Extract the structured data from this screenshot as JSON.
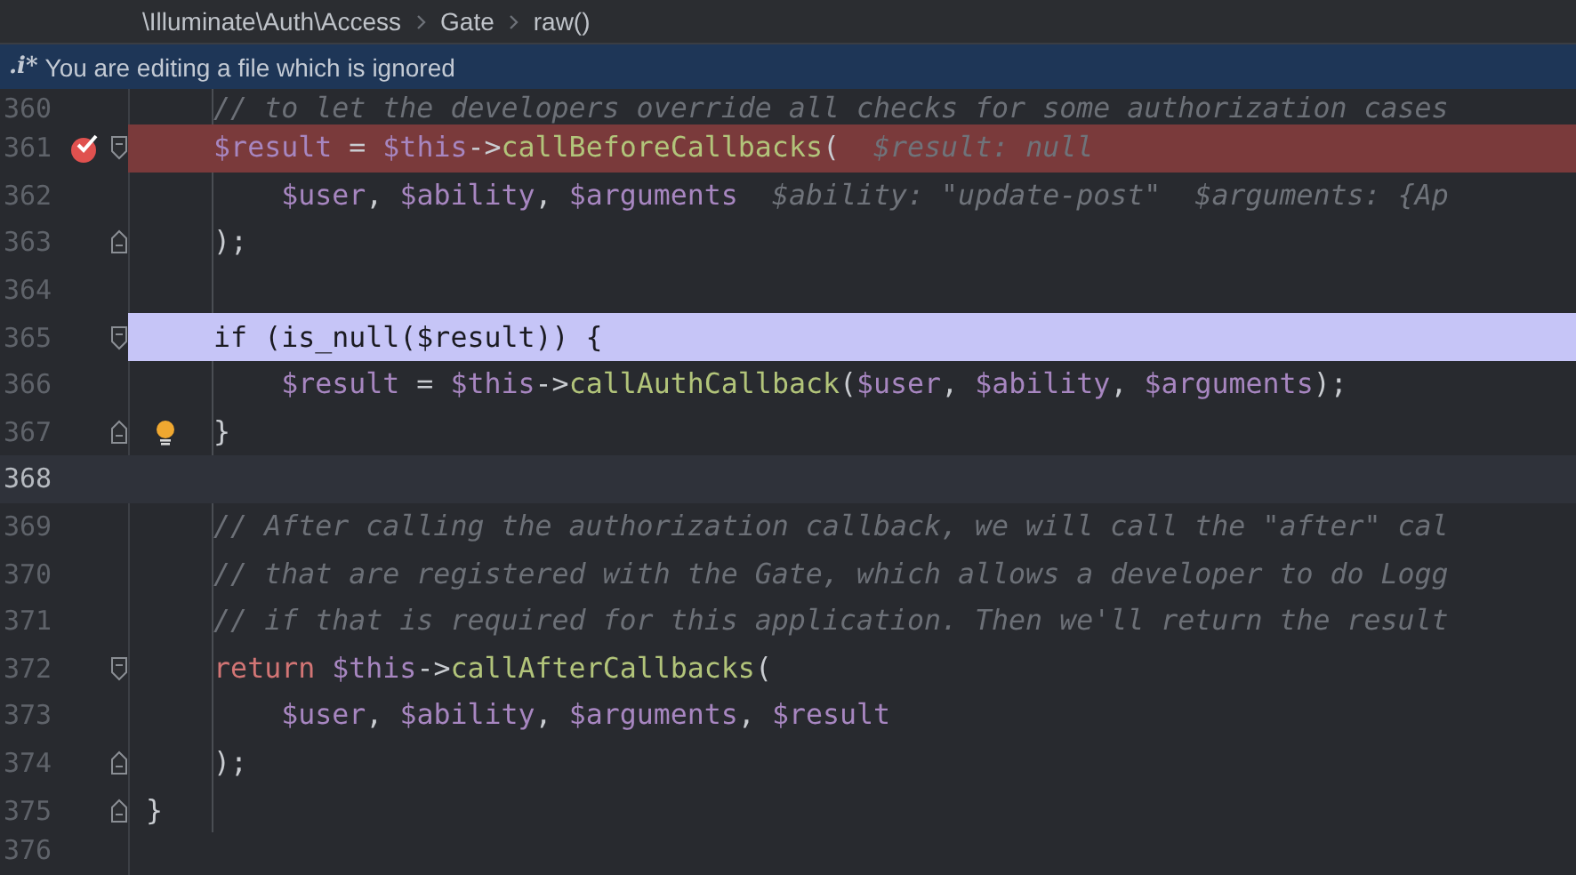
{
  "breadcrumbs": [
    "\\Illuminate\\Auth\\Access",
    "Gate",
    "raw()"
  ],
  "notice": {
    "prefix": ".i*",
    "text": "You are editing a file which is ignored"
  },
  "lines": [
    {
      "number": "360",
      "breakpoint": false,
      "execution_point": false,
      "caret_line": false,
      "fold_start": false,
      "fold_end": false,
      "bulb": false,
      "tokens": [
        {
          "kind": "comment",
          "text": "    // to let the developers override all checks for some authorization cases"
        }
      ]
    },
    {
      "number": "361",
      "breakpoint": true,
      "execution_point": false,
      "caret_line": false,
      "fold_start": true,
      "fold_end": false,
      "bulb": false,
      "tokens": [
        {
          "kind": "var",
          "text": "    $result"
        },
        {
          "kind": "plain",
          "text": " = "
        },
        {
          "kind": "var",
          "text": "$this"
        },
        {
          "kind": "plain",
          "text": "->"
        },
        {
          "kind": "func",
          "text": "callBeforeCallbacks"
        },
        {
          "kind": "plain",
          "text": "(  "
        },
        {
          "kind": "hint",
          "text": "$result: null"
        }
      ]
    },
    {
      "number": "362",
      "breakpoint": false,
      "execution_point": false,
      "caret_line": false,
      "fold_start": false,
      "fold_end": false,
      "bulb": false,
      "tokens": [
        {
          "kind": "var",
          "text": "        $user"
        },
        {
          "kind": "plain",
          "text": ", "
        },
        {
          "kind": "var",
          "text": "$ability"
        },
        {
          "kind": "plain",
          "text": ", "
        },
        {
          "kind": "var",
          "text": "$arguments"
        },
        {
          "kind": "hint",
          "text": "  $ability: \"update-post\"  $arguments: {Ap"
        }
      ]
    },
    {
      "number": "363",
      "breakpoint": false,
      "execution_point": false,
      "caret_line": false,
      "fold_start": false,
      "fold_end": true,
      "bulb": false,
      "tokens": [
        {
          "kind": "plain",
          "text": "    );"
        }
      ]
    },
    {
      "number": "364",
      "breakpoint": false,
      "execution_point": false,
      "caret_line": false,
      "fold_start": false,
      "fold_end": false,
      "bulb": false
    },
    {
      "number": "365",
      "breakpoint": false,
      "execution_point": true,
      "caret_line": false,
      "fold_start": true,
      "fold_end": false,
      "bulb": false,
      "tokens": [
        {
          "kind": "plain",
          "text": "    if (is_null($result)) {"
        }
      ]
    },
    {
      "number": "366",
      "breakpoint": false,
      "execution_point": false,
      "caret_line": false,
      "fold_start": false,
      "fold_end": false,
      "bulb": false,
      "tokens": [
        {
          "kind": "var",
          "text": "        $result"
        },
        {
          "kind": "plain",
          "text": " = "
        },
        {
          "kind": "var",
          "text": "$this"
        },
        {
          "kind": "plain",
          "text": "->"
        },
        {
          "kind": "func",
          "text": "callAuthCallback"
        },
        {
          "kind": "plain",
          "text": "("
        },
        {
          "kind": "var",
          "text": "$user"
        },
        {
          "kind": "plain",
          "text": ", "
        },
        {
          "kind": "var",
          "text": "$ability"
        },
        {
          "kind": "plain",
          "text": ", "
        },
        {
          "kind": "var",
          "text": "$arguments"
        },
        {
          "kind": "plain",
          "text": ");"
        }
      ]
    },
    {
      "number": "367",
      "breakpoint": false,
      "execution_point": false,
      "caret_line": false,
      "fold_start": false,
      "fold_end": true,
      "bulb": true,
      "tokens": [
        {
          "kind": "plain",
          "text": "    }"
        }
      ]
    },
    {
      "number": "368",
      "breakpoint": false,
      "execution_point": false,
      "caret_line": true,
      "fold_start": false,
      "fold_end": false,
      "bulb": false
    },
    {
      "number": "369",
      "breakpoint": false,
      "execution_point": false,
      "caret_line": false,
      "fold_start": false,
      "fold_end": false,
      "bulb": false,
      "tokens": [
        {
          "kind": "comment",
          "text": "    // After calling the authorization callback, we will call the \"after\" cal"
        }
      ]
    },
    {
      "number": "370",
      "breakpoint": false,
      "execution_point": false,
      "caret_line": false,
      "fold_start": false,
      "fold_end": false,
      "bulb": false,
      "tokens": [
        {
          "kind": "comment",
          "text": "    // that are registered with the Gate, which allows a developer to do Logg"
        }
      ]
    },
    {
      "number": "371",
      "breakpoint": false,
      "execution_point": false,
      "caret_line": false,
      "fold_start": false,
      "fold_end": false,
      "bulb": false,
      "tokens": [
        {
          "kind": "comment",
          "text": "    // if that is required for this application. Then we'll return the result"
        }
      ]
    },
    {
      "number": "372",
      "breakpoint": false,
      "execution_point": false,
      "caret_line": false,
      "fold_start": true,
      "fold_end": false,
      "bulb": false,
      "tokens": [
        {
          "kind": "keyword",
          "text": "    return"
        },
        {
          "kind": "var",
          "text": " $this"
        },
        {
          "kind": "plain",
          "text": "->"
        },
        {
          "kind": "func",
          "text": "callAfterCallbacks"
        },
        {
          "kind": "plain",
          "text": "("
        }
      ]
    },
    {
      "number": "373",
      "breakpoint": false,
      "execution_point": false,
      "caret_line": false,
      "fold_start": false,
      "fold_end": false,
      "bulb": false,
      "tokens": [
        {
          "kind": "var",
          "text": "        $user"
        },
        {
          "kind": "plain",
          "text": ", "
        },
        {
          "kind": "var",
          "text": "$ability"
        },
        {
          "kind": "plain",
          "text": ", "
        },
        {
          "kind": "var",
          "text": "$arguments"
        },
        {
          "kind": "plain",
          "text": ", "
        },
        {
          "kind": "var",
          "text": "$result"
        }
      ]
    },
    {
      "number": "374",
      "breakpoint": false,
      "execution_point": false,
      "caret_line": false,
      "fold_start": false,
      "fold_end": true,
      "bulb": false,
      "tokens": [
        {
          "kind": "plain",
          "text": "    );"
        }
      ]
    },
    {
      "number": "375",
      "breakpoint": false,
      "execution_point": false,
      "caret_line": false,
      "fold_start": false,
      "fold_end": true,
      "bulb": false,
      "tokens": [
        {
          "kind": "plain",
          "text": "}"
        }
      ]
    },
    {
      "number": "376",
      "breakpoint": false,
      "execution_point": false,
      "caret_line": false,
      "fold_start": false,
      "fold_end": false,
      "bulb": false
    }
  ]
}
